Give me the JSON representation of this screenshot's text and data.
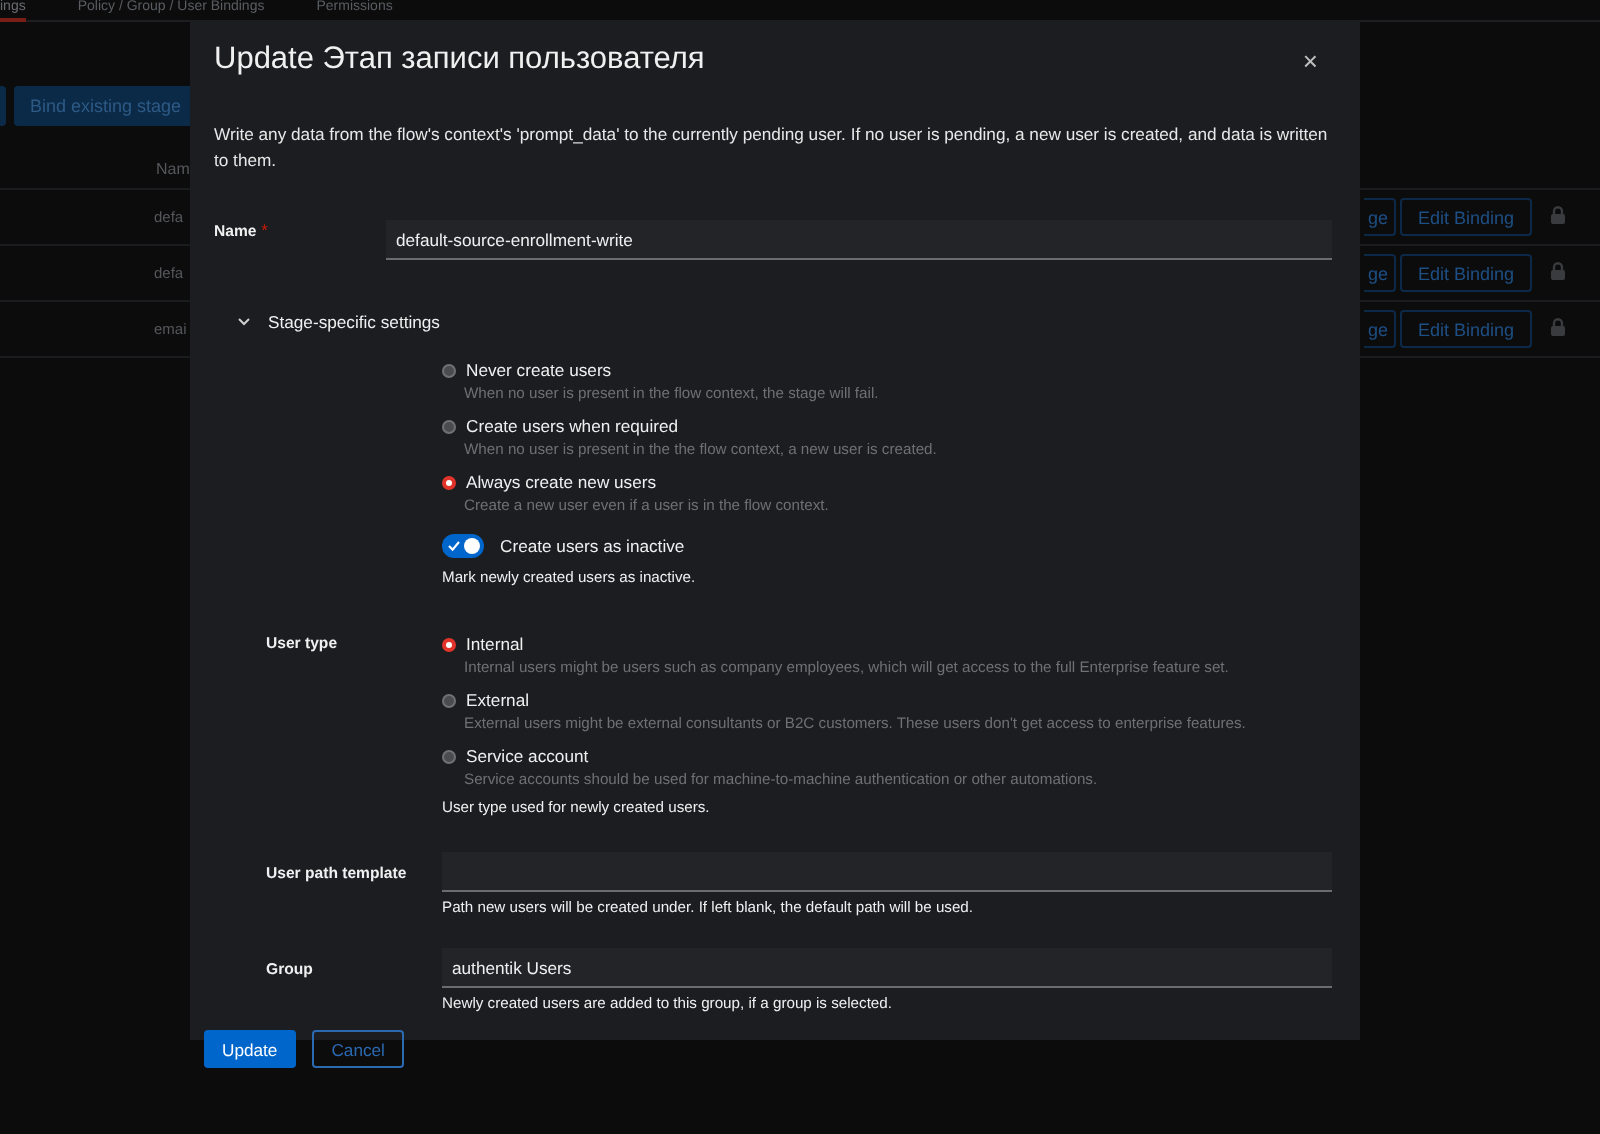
{
  "page": {
    "tabs": [
      {
        "label": "ings",
        "selected": true
      },
      {
        "label": "Policy / Group / User Bindings",
        "selected": false
      },
      {
        "label": "Permissions",
        "selected": false
      }
    ],
    "bind_button": "Bind existing stage",
    "table": {
      "column_1": "Nam",
      "rows": [
        {
          "name": "defa",
          "button_partial": "ge",
          "edit_button": "Edit Binding"
        },
        {
          "name": "defa",
          "button_partial": "ge",
          "edit_button": "Edit Binding"
        },
        {
          "name": "emai",
          "button_partial": "ge",
          "edit_button": "Edit Binding"
        }
      ]
    }
  },
  "modal": {
    "title": "Update Этап записи пользователя",
    "close": "×",
    "description": "Write any data from the flow's context's 'prompt_data' to the currently pending user. If no user is pending, a new user is created, and data is written to them.",
    "name_field": {
      "label": "Name",
      "required_mark": "*",
      "value": "default-source-enrollment-write"
    },
    "section": {
      "label": "Stage-specific settings",
      "expanded": true
    },
    "creation_mode": [
      {
        "label": "Never create users",
        "help": "When no user is present in the flow context, the stage will fail.",
        "selected": false
      },
      {
        "label": "Create users when required",
        "help": "When no user is present in the the flow context, a new user is created.",
        "selected": false
      },
      {
        "label": "Always create new users",
        "help": "Create a new user even if a user is in the flow context.",
        "selected": true
      }
    ],
    "inactive_toggle": {
      "label": "Create users as inactive",
      "on": true,
      "help": "Mark newly created users as inactive."
    },
    "user_type": {
      "label": "User type",
      "options": [
        {
          "label": "Internal",
          "help": "Internal users might be users such as company employees, which will get access to the full Enterprise feature set.",
          "selected": true
        },
        {
          "label": "External",
          "help": "External users might be external consultants or B2C customers. These users don't get access to enterprise features.",
          "selected": false
        },
        {
          "label": "Service account",
          "help": "Service accounts should be used for machine-to-machine authentication or other automations.",
          "selected": false
        }
      ],
      "help": "User type used for newly created users."
    },
    "user_path": {
      "label": "User path template",
      "help": "Path new users will be created under. If left blank, the default path will be used."
    },
    "group": {
      "label": "Group",
      "value": "authentik Users",
      "help": "Newly created users are added to this group, if a group is selected."
    },
    "buttons": [
      {
        "label": "Update",
        "kind": "primary"
      },
      {
        "label": "Cancel",
        "kind": "secondary"
      }
    ]
  }
}
